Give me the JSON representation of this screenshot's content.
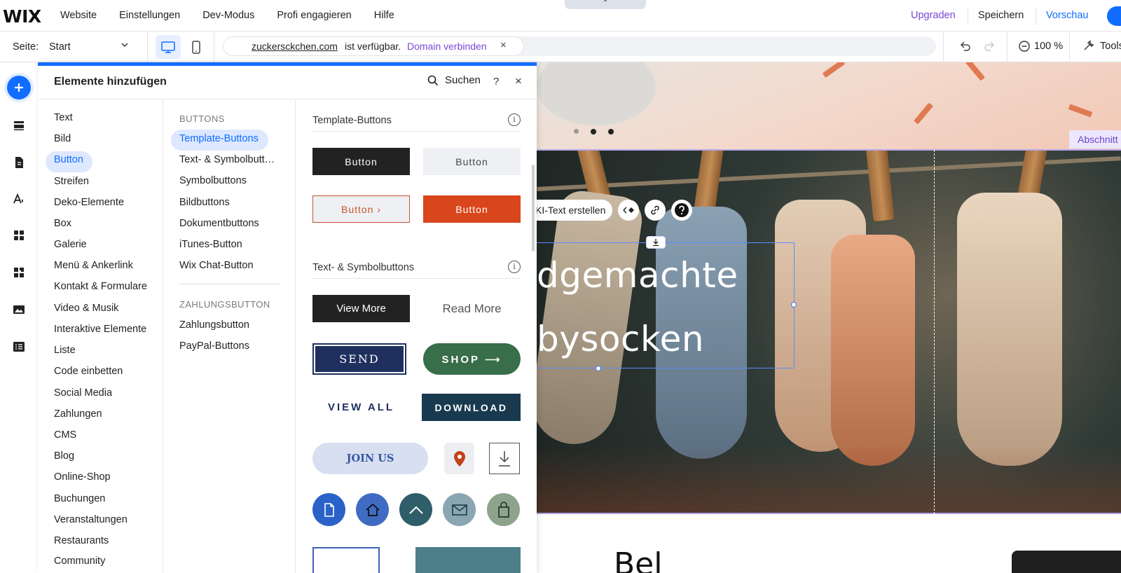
{
  "app": {
    "logo": "WIX"
  },
  "top_nav": [
    "Website",
    "Einstellungen",
    "Dev-Modus",
    "Profi engagieren",
    "Hilfe"
  ],
  "top_right": {
    "upgrade": "Upgraden",
    "save": "Speichern",
    "preview": "Vorschau"
  },
  "collapse_glyph": "⌃",
  "page_bar": {
    "page_label": "Seite:",
    "page_value": "Start",
    "domain": "zuckersckchen.com",
    "availability": "ist verfügbar.",
    "connect": "Domain verbinden",
    "close": "×",
    "zoom": "100 %",
    "tools": "Tools"
  },
  "panel": {
    "title": "Elemente hinzufügen",
    "search": "Suchen",
    "help": "?",
    "close": "×",
    "categories": [
      "Text",
      "Bild",
      "Button",
      "Streifen",
      "Deko-Elemente",
      "Box",
      "Galerie",
      "Menü & Ankerlink",
      "Kontakt & Formulare",
      "Video & Musik",
      "Interaktive Elemente",
      "Liste",
      "Code einbetten",
      "Social Media",
      "Zahlungen",
      "CMS",
      "Blog",
      "Online-Shop",
      "Buchungen",
      "Veranstaltungen",
      "Restaurants",
      "Community"
    ],
    "selected_category": "Button",
    "sub_heading_1": "BUTTONS",
    "sub_items_1": [
      "Template-Buttons",
      "Text- & Symbolbutt…",
      "Symbolbuttons",
      "Bildbuttons",
      "Dokumentbuttons",
      "iTunes-Button",
      "Wix Chat-Button"
    ],
    "sub_heading_2": "ZAHLUNGSBUTTON",
    "sub_items_2": [
      "Zahlungsbutton",
      "PayPal-Buttons"
    ],
    "section_1_title": "Template-Buttons",
    "section_2_title": "Text- & Symbolbuttons",
    "info_glyph": "i",
    "template_buttons": [
      "Button",
      "Button",
      "Button ›",
      "Button"
    ],
    "text_icon_buttons": [
      "View More",
      "Read More",
      "SEND",
      "SHOP ⟶",
      "VIEW ALL",
      "DOWNLOAD",
      "JOIN US"
    ]
  },
  "canvas": {
    "section_tag": "Abschnitt",
    "ai_text": "KI-Text erstellen",
    "hero_line_1": "dgemachte",
    "hero_line_2": "bysocken",
    "below_text": "Bel"
  },
  "colors": {
    "accent": "#116dff",
    "upgrade": "#7a46d8",
    "selected_bg": "#dde8ff"
  }
}
